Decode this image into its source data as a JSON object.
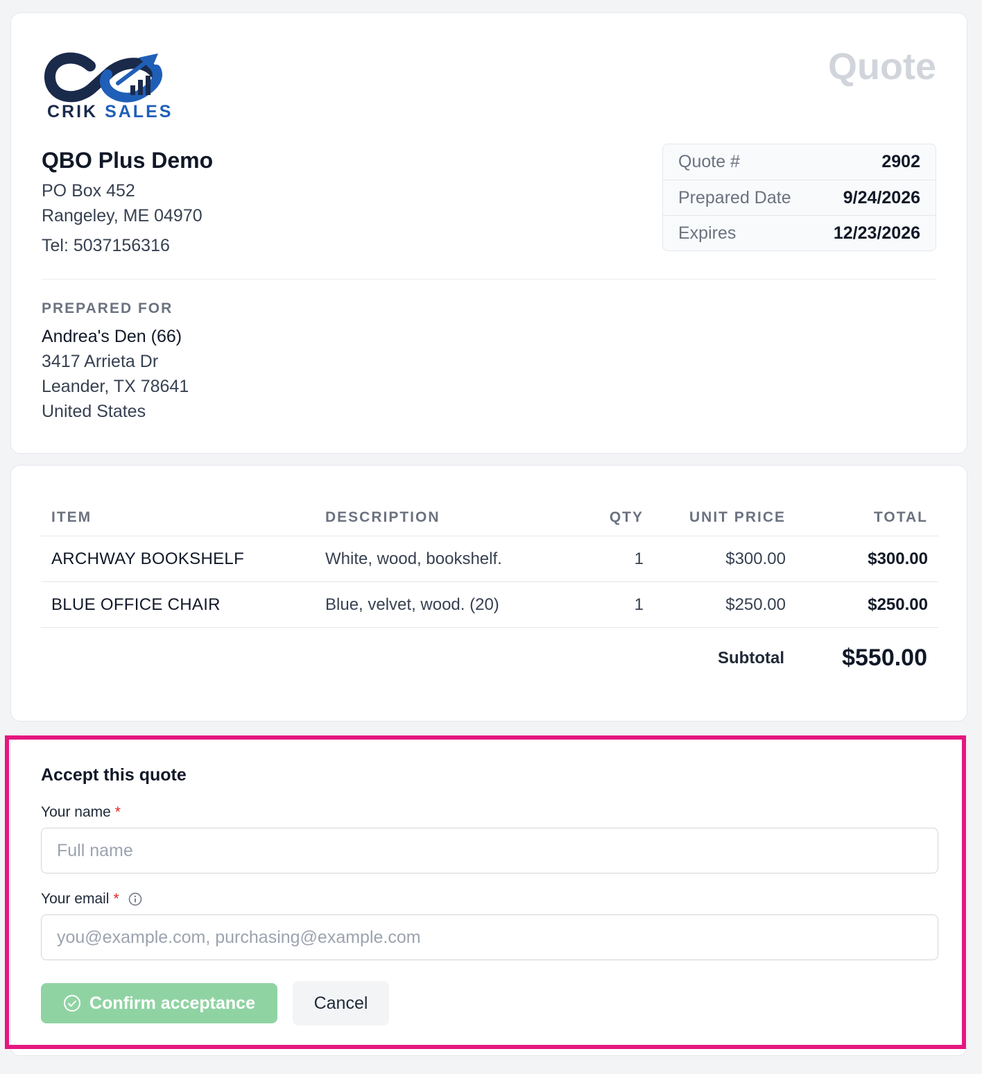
{
  "brand": {
    "logo_word1": "CRIK",
    "logo_word2": "SALES",
    "colors": {
      "navy": "#1a2a4a",
      "blue": "#1f5fb8"
    }
  },
  "document": {
    "title": "Quote"
  },
  "company": {
    "name": "QBO Plus Demo",
    "address_line1": "PO Box 452",
    "address_line2": "Rangeley, ME 04970",
    "phone": "Tel: 5037156316"
  },
  "meta": [
    {
      "label": "Quote #",
      "value": "2902"
    },
    {
      "label": "Prepared Date",
      "value": "9/24/2026"
    },
    {
      "label": "Expires",
      "value": "12/23/2026"
    }
  ],
  "prepared_for": {
    "label": "PREPARED FOR",
    "name": "Andrea's Den (66)",
    "line1": "3417 Arrieta Dr",
    "line2": "Leander, TX 78641",
    "line3": "United States"
  },
  "items_table": {
    "headers": [
      "ITEM",
      "DESCRIPTION",
      "QTY",
      "UNIT PRICE",
      "TOTAL"
    ],
    "rows": [
      {
        "item": "ARCHWAY BOOKSHELF",
        "description": "White, wood, bookshelf.",
        "qty": "1",
        "unit_price": "$300.00",
        "total": "$300.00"
      },
      {
        "item": "BLUE OFFICE CHAIR",
        "description": "Blue, velvet, wood. (20)",
        "qty": "1",
        "unit_price": "$250.00",
        "total": "$250.00"
      }
    ],
    "subtotal_label": "Subtotal",
    "subtotal_value": "$550.00"
  },
  "accept": {
    "title": "Accept this quote",
    "name_label": "Your name",
    "name_placeholder": "Full name",
    "email_label": "Your email",
    "email_placeholder": "you@example.com, purchasing@example.com",
    "required_marker": "*",
    "confirm_label": "Confirm acceptance",
    "cancel_label": "Cancel",
    "colors": {
      "confirm_bg": "#90d3a3",
      "highlight_border": "#e5177e",
      "required": "#dc2626"
    }
  }
}
